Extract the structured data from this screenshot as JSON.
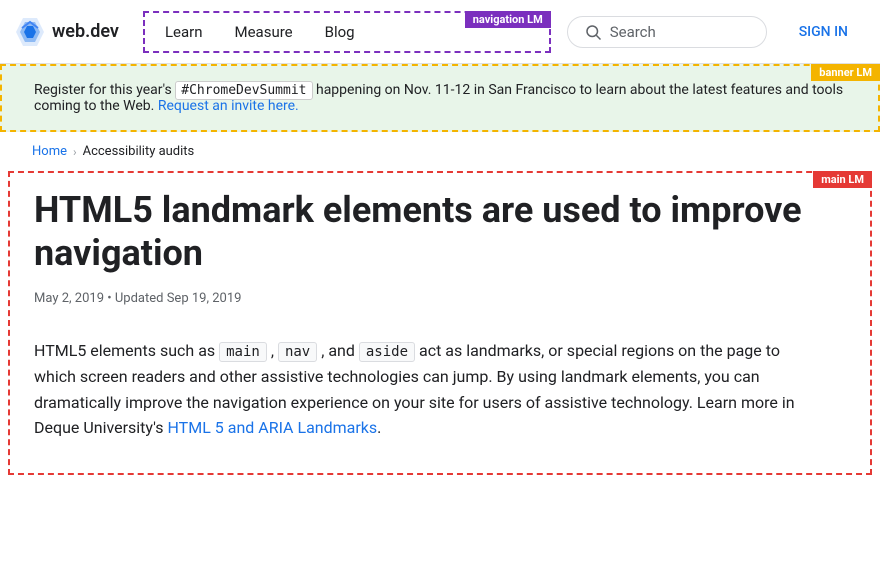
{
  "header": {
    "logo_text": "web.dev",
    "nav_label": "navigation LM",
    "nav_items": [
      "Learn",
      "Measure",
      "Blog"
    ],
    "search_placeholder": "Search",
    "sign_in": "SIGN IN"
  },
  "banner": {
    "label": "banner LM",
    "text_before": "Register for this year's",
    "hashtag": "#ChromeDevSummit",
    "text_middle": "happening on Nov. 11-12 in San Francisco to learn about the latest features and tools coming to the Web.",
    "link_text": "Request an invite here.",
    "link_href": "#"
  },
  "breadcrumb": {
    "home": "Home",
    "current": "Accessibility audits"
  },
  "article": {
    "title": "HTML5 landmark elements are used to improve navigation",
    "date": "May 2, 2019",
    "updated": "Updated Sep 19, 2019",
    "main_label": "main LM",
    "body_intro": "HTML5 elements such as",
    "code1": "main",
    "code2": "nav",
    "code3": "aside",
    "body_after_code": "act as landmarks, or special regions on the page to which screen readers and other assistive technologies can jump. By using landmark elements, you can dramatically improve the navigation experience on your site for users of assistive technology. Learn more in Deque University's",
    "link_text": "HTML 5 and ARIA Landmarks",
    "link_href": "#",
    "body_end": "."
  }
}
